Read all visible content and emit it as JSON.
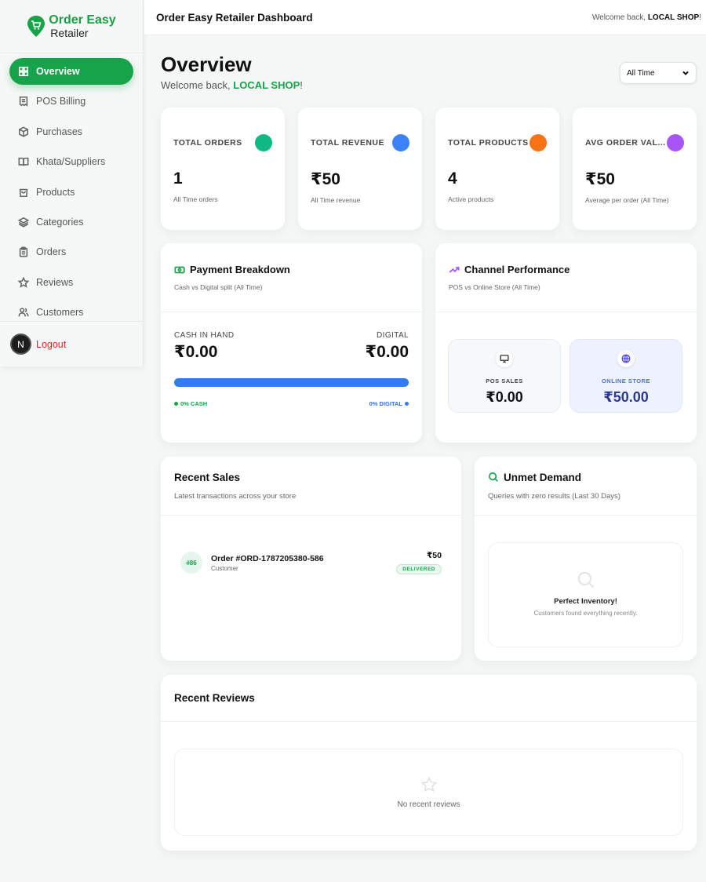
{
  "brand": {
    "title": "Order Easy",
    "subtitle": "Retailer"
  },
  "sidebar": {
    "items": [
      {
        "label": "Overview",
        "icon": "grid-icon",
        "active": true
      },
      {
        "label": "POS Billing",
        "icon": "receipt-icon"
      },
      {
        "label": "Purchases",
        "icon": "box-icon"
      },
      {
        "label": "Khata/Suppliers",
        "icon": "book-icon"
      },
      {
        "label": "Products",
        "icon": "bag-icon"
      },
      {
        "label": "Categories",
        "icon": "layers-icon"
      },
      {
        "label": "Orders",
        "icon": "clipboard-icon"
      },
      {
        "label": "Reviews",
        "icon": "star-icon"
      },
      {
        "label": "Customers",
        "icon": "users-icon"
      }
    ],
    "avatar_letter": "N",
    "logout_label": "Logout"
  },
  "header": {
    "title": "Order Easy Retailer Dashboard",
    "welcome_prefix": "Welcome back, ",
    "shop_name": "LOCAL SHOP",
    "welcome_suffix": "!"
  },
  "page": {
    "title": "Overview",
    "sub_prefix": "Welcome back, ",
    "shop_name": "LOCAL SHOP",
    "sub_suffix": "!",
    "period": "All Time"
  },
  "stats": [
    {
      "label": "TOTAL ORDERS",
      "value": "1",
      "note": "All Time orders",
      "color": "#10b981"
    },
    {
      "label": "TOTAL REVENUE",
      "value": "₹50",
      "note": "All Time revenue",
      "color": "#3b82f6"
    },
    {
      "label": "TOTAL PRODUCTS",
      "value": "4",
      "note": "Active products",
      "color": "#f97316"
    },
    {
      "label": "AVG ORDER VAL...",
      "value": "₹50",
      "note": "Average per order (All Time)",
      "color": "#a855f7"
    }
  ],
  "payment": {
    "title": "Payment Breakdown",
    "subtitle": "Cash vs Digital split (All Time)",
    "cash_label": "CASH IN HAND",
    "cash_value": "₹0.00",
    "digital_label": "DIGITAL",
    "digital_value": "₹0.00",
    "cash_pct_label": "0% CASH",
    "digital_pct_label": "0% DIGITAL"
  },
  "channel": {
    "title": "Channel Performance",
    "subtitle": "POS vs Online Store (All Time)",
    "pos_label": "POS SALES",
    "pos_value": "₹0.00",
    "online_label": "ONLINE STORE",
    "online_value": "₹50.00"
  },
  "recent_sales": {
    "title": "Recent Sales",
    "subtitle": "Latest transactions across your store",
    "rows": [
      {
        "badge": "#86",
        "order": "Order #ORD-1787205380-586",
        "customer": "Customer",
        "amount": "₹50",
        "status": "DELIVERED"
      }
    ]
  },
  "unmet": {
    "title": "Unmet Demand",
    "subtitle": "Queries with zero results (Last 30 Days)",
    "empty_title": "Perfect Inventory!",
    "empty_sub": "Customers found everything recently."
  },
  "reviews": {
    "title": "Recent Reviews",
    "empty_text": "No recent reviews"
  },
  "colors": {
    "accent": "#17a34a",
    "blue": "#2f7df1",
    "danger": "#e02424"
  }
}
